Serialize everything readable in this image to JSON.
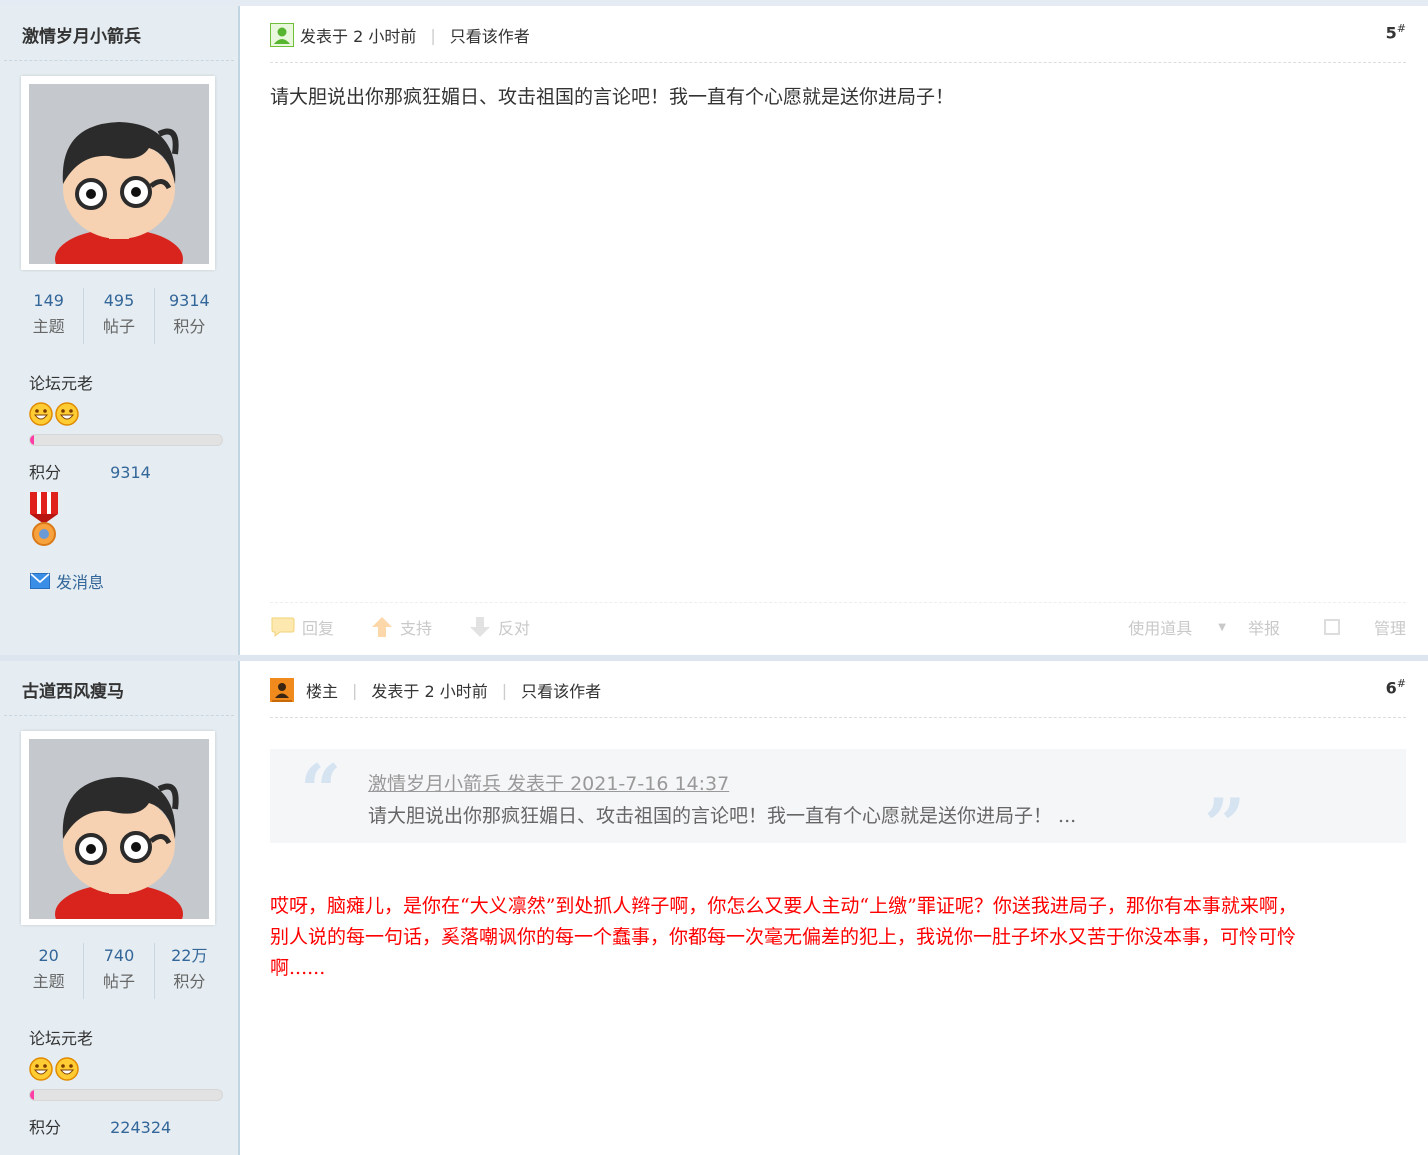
{
  "posts": [
    {
      "user": {
        "name": "激情岁月小箭兵",
        "stats": [
          {
            "num": "149",
            "label": "主题"
          },
          {
            "num": "495",
            "label": "帖子"
          },
          {
            "num": "9314",
            "label": "积分"
          }
        ],
        "rank": "论坛元老",
        "level_progress": 0.02,
        "score_label": "积分",
        "score_value": "9314",
        "send_message": "发消息"
      },
      "header": {
        "posted": "发表于 2 小时前",
        "only_author": "只看该作者",
        "floor": "5",
        "floor_mark": "#"
      },
      "content": "请大胆说出你那疯狂媚日、攻击祖国的言论吧！我一直有个心愿就是送你进局子！",
      "footer": {
        "reply": "回复",
        "support": "支持",
        "oppose": "反对",
        "use_tool": "使用道具",
        "report": "举报",
        "manage": "管理"
      }
    },
    {
      "user": {
        "name": "古道西风瘦马",
        "stats": [
          {
            "num": "20",
            "label": "主题"
          },
          {
            "num": "740",
            "label": "帖子"
          },
          {
            "num": "22万",
            "label": "积分"
          }
        ],
        "rank": "论坛元老",
        "level_progress": 0.02,
        "score_label": "积分",
        "score_value": "224324"
      },
      "header": {
        "op_label": "楼主",
        "posted": "发表于 2 小时前",
        "only_author": "只看该作者",
        "floor": "6",
        "floor_mark": "#"
      },
      "quote": {
        "meta": "激情岁月小箭兵 发表于 2021-7-16 14:37",
        "text": "请大胆说出你那疯狂媚日、攻击祖国的言论吧！我一直有个心愿就是送你进局子！ ..."
      },
      "reply_lines": [
        "哎呀，脑瘫儿，是你在“大义凛然”到处抓人辫子啊，你怎么又要人主动“上缴”罪证呢？你送我进局子，那你有本事就来啊，",
        "别人说的每一句话，奚落嘲讽你的每一个蠢事，你都每一次毫无偏差的犯上，我说你一肚子坏水又苦于你没本事，可怜可怜",
        "啊......"
      ]
    }
  ],
  "icons": {
    "post_icon_1": "user-online-icon",
    "post_icon_2": "thread-starter-icon",
    "reply": "speech-bubble-icon",
    "support": "thumb-up-arrow-icon",
    "oppose": "thumb-down-arrow-icon",
    "message": "envelope-icon",
    "medal": "medal-icon",
    "rank_stars": "smiley-icon"
  },
  "colors": {
    "link": "#336699",
    "reply_text": "#ff0000",
    "sidebar_bg": "#e5edf2",
    "progress_fill": "#ff3ea5"
  }
}
